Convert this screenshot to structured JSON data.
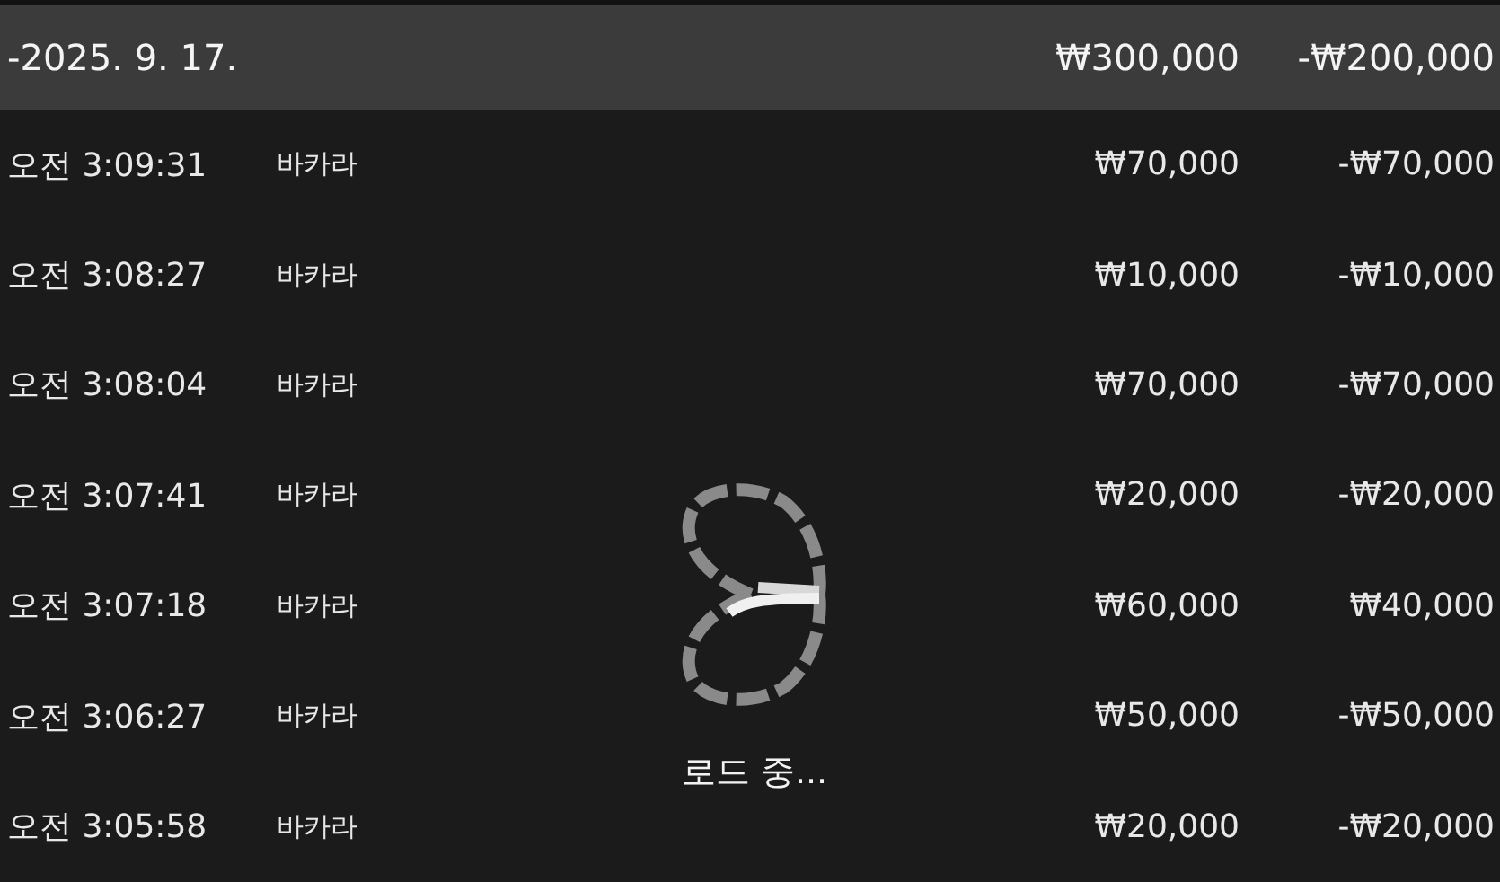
{
  "summary": {
    "date": "-2025. 9. 17.",
    "bet_total": "₩300,000",
    "net_total": "-₩200,000"
  },
  "rows": [
    {
      "time": "오전 3:09:31",
      "game": "바카라",
      "bet": "₩70,000",
      "net": "-₩70,000"
    },
    {
      "time": "오전 3:08:27",
      "game": "바카라",
      "bet": "₩10,000",
      "net": "-₩10,000"
    },
    {
      "time": "오전 3:08:04",
      "game": "바카라",
      "bet": "₩70,000",
      "net": "-₩70,000"
    },
    {
      "time": "오전 3:07:41",
      "game": "바카라",
      "bet": "₩20,000",
      "net": "-₩20,000"
    },
    {
      "time": "오전 3:07:18",
      "game": "바카라",
      "bet": "₩60,000",
      "net": "₩40,000"
    },
    {
      "time": "오전 3:06:27",
      "game": "바카라",
      "bet": "₩50,000",
      "net": "-₩50,000"
    },
    {
      "time": "오전 3:05:58",
      "game": "바카라",
      "bet": "₩20,000",
      "net": "-₩20,000"
    }
  ],
  "loading": {
    "label": "로드 중..."
  }
}
